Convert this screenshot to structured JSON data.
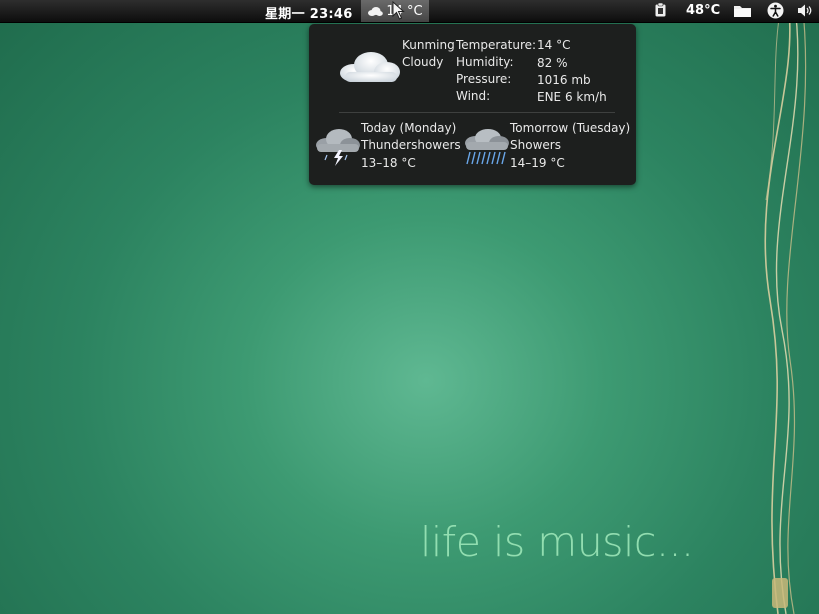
{
  "panel": {
    "clock": "星期一 23:46",
    "weather_temp": "14 °C",
    "cpu_temp": "48°C"
  },
  "popup": {
    "location": "Kunming",
    "condition": "Cloudy",
    "labels": {
      "temperature": "Temperature:",
      "humidity": "Humidity:",
      "pressure": "Pressure:",
      "wind": "Wind:"
    },
    "values": {
      "temperature": "14 °C",
      "humidity": "82 %",
      "pressure": "1016 mb",
      "wind": "ENE 6 km/h"
    },
    "forecast": [
      {
        "day": "Today (Monday)",
        "condition": "Thundershowers",
        "range": "13–18 °C",
        "icon": "thunderstorm-icon"
      },
      {
        "day": "Tomorrow (Tuesday)",
        "condition": "Showers",
        "range": "14–19 °C",
        "icon": "rain-icon"
      }
    ]
  },
  "wallpaper": {
    "slogan": "life is music..."
  },
  "colors": {
    "panel": "#151515",
    "popup_bg": "#1d1f1e",
    "desktop": "#2c8360",
    "slogan": "#9ce6b8"
  }
}
